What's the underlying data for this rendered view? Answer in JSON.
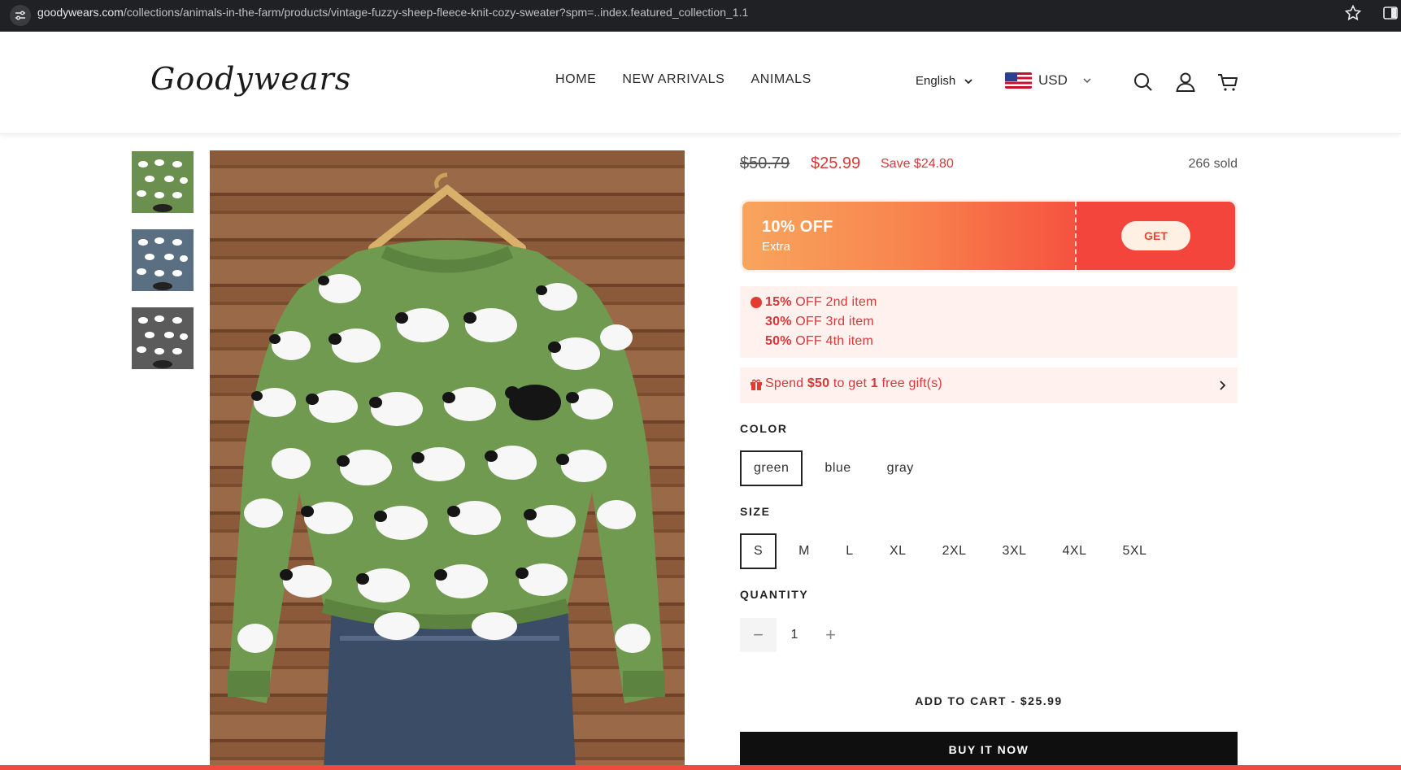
{
  "browser": {
    "url_host": "goodywears.com",
    "url_path": "/collections/animals-in-the-farm/products/vintage-fuzzy-sheep-fleece-knit-cozy-sweater?spm=..index.featured_collection_1.1"
  },
  "header": {
    "logo": "Goodywears",
    "nav": [
      "HOME",
      "NEW ARRIVALS",
      "ANIMALS"
    ],
    "language": "English",
    "currency": "USD"
  },
  "gallery": {
    "thumbnail_colors": [
      "#6b8f4e",
      "#5a6f82",
      "#5b5b5b"
    ],
    "main_sweater_color": "#6f9a4f"
  },
  "product": {
    "old_price": "$50.79",
    "price": "$25.99",
    "save": "Save $24.80",
    "sold": "266 sold"
  },
  "coupon": {
    "discount": "10% OFF",
    "subtitle": "Extra",
    "button": "GET"
  },
  "tiers": [
    {
      "pct": "15%",
      "text": " OFF 2nd item"
    },
    {
      "pct": "30%",
      "text": " OFF 3rd item"
    },
    {
      "pct": "50%",
      "text": " OFF 4th item"
    }
  ],
  "gift": {
    "pre": "Spend ",
    "amount": "$50",
    "mid": " to get ",
    "count": "1",
    "post": " free gift(s)"
  },
  "color": {
    "label": "COLOR",
    "options": [
      "green",
      "blue",
      "gray"
    ],
    "selected": "green"
  },
  "size": {
    "label": "SIZE",
    "options": [
      "S",
      "M",
      "L",
      "XL",
      "2XL",
      "3XL",
      "4XL",
      "5XL"
    ],
    "selected": "S"
  },
  "quantity": {
    "label": "QUANTITY",
    "minus": "−",
    "value": "1",
    "plus": "+"
  },
  "actions": {
    "add_to_cart": "ADD TO CART - $25.99",
    "buy_now": "BUY IT NOW"
  },
  "colors": {
    "sale_red": "#d9383a",
    "coupon_orange": "#f8844e",
    "buy_now_bg": "#0f0f0f"
  }
}
